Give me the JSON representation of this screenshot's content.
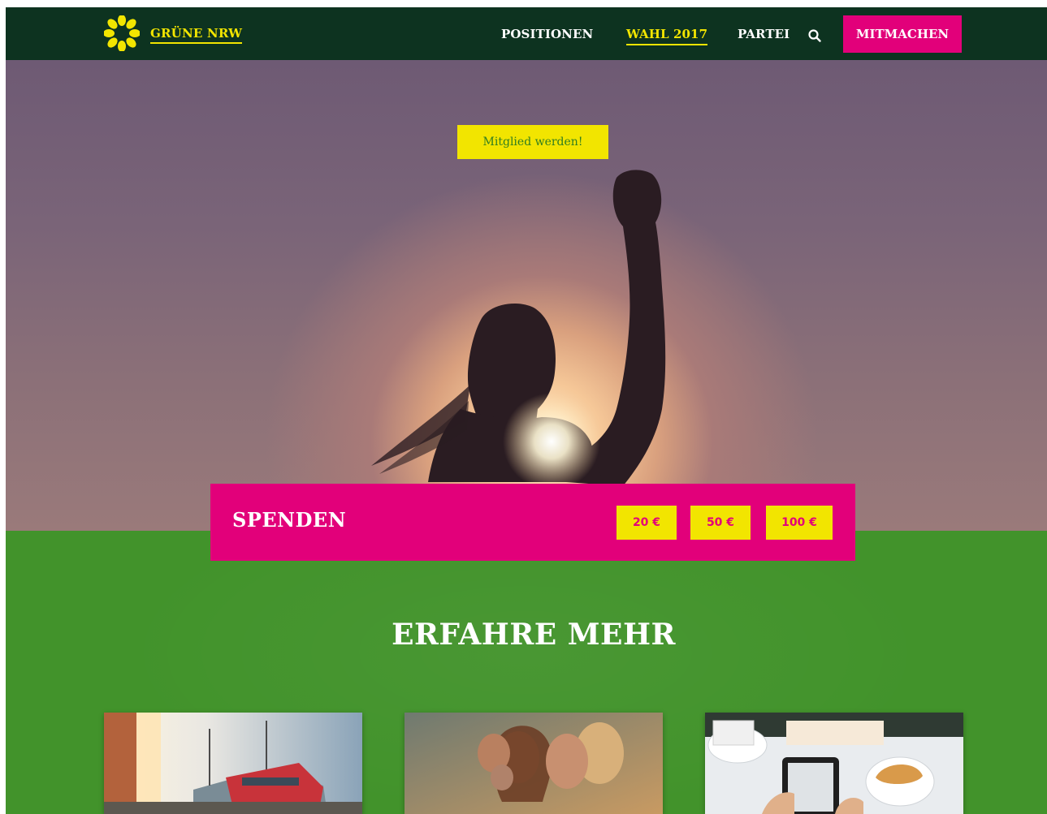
{
  "header": {
    "brand": "GRÜNE NRW",
    "nav": [
      {
        "label": "POSITIONEN"
      },
      {
        "label": "WAHL 2017",
        "active": true
      },
      {
        "label": "PARTEI"
      }
    ],
    "cta": "MITMACHEN"
  },
  "hero": {
    "member_button": "Mitglied werden!"
  },
  "donate": {
    "title": "SPENDEN",
    "amounts": [
      "20 €",
      "50 €",
      "100 €"
    ]
  },
  "more": {
    "title": "ERFAHRE MEHR"
  },
  "colors": {
    "header_bg": "#0d3320",
    "accent_yellow": "#f2e500",
    "magenta": "#e2007a",
    "green_section": "#42932b"
  },
  "icons": [
    "sunflower-logo-icon",
    "search-icon"
  ]
}
